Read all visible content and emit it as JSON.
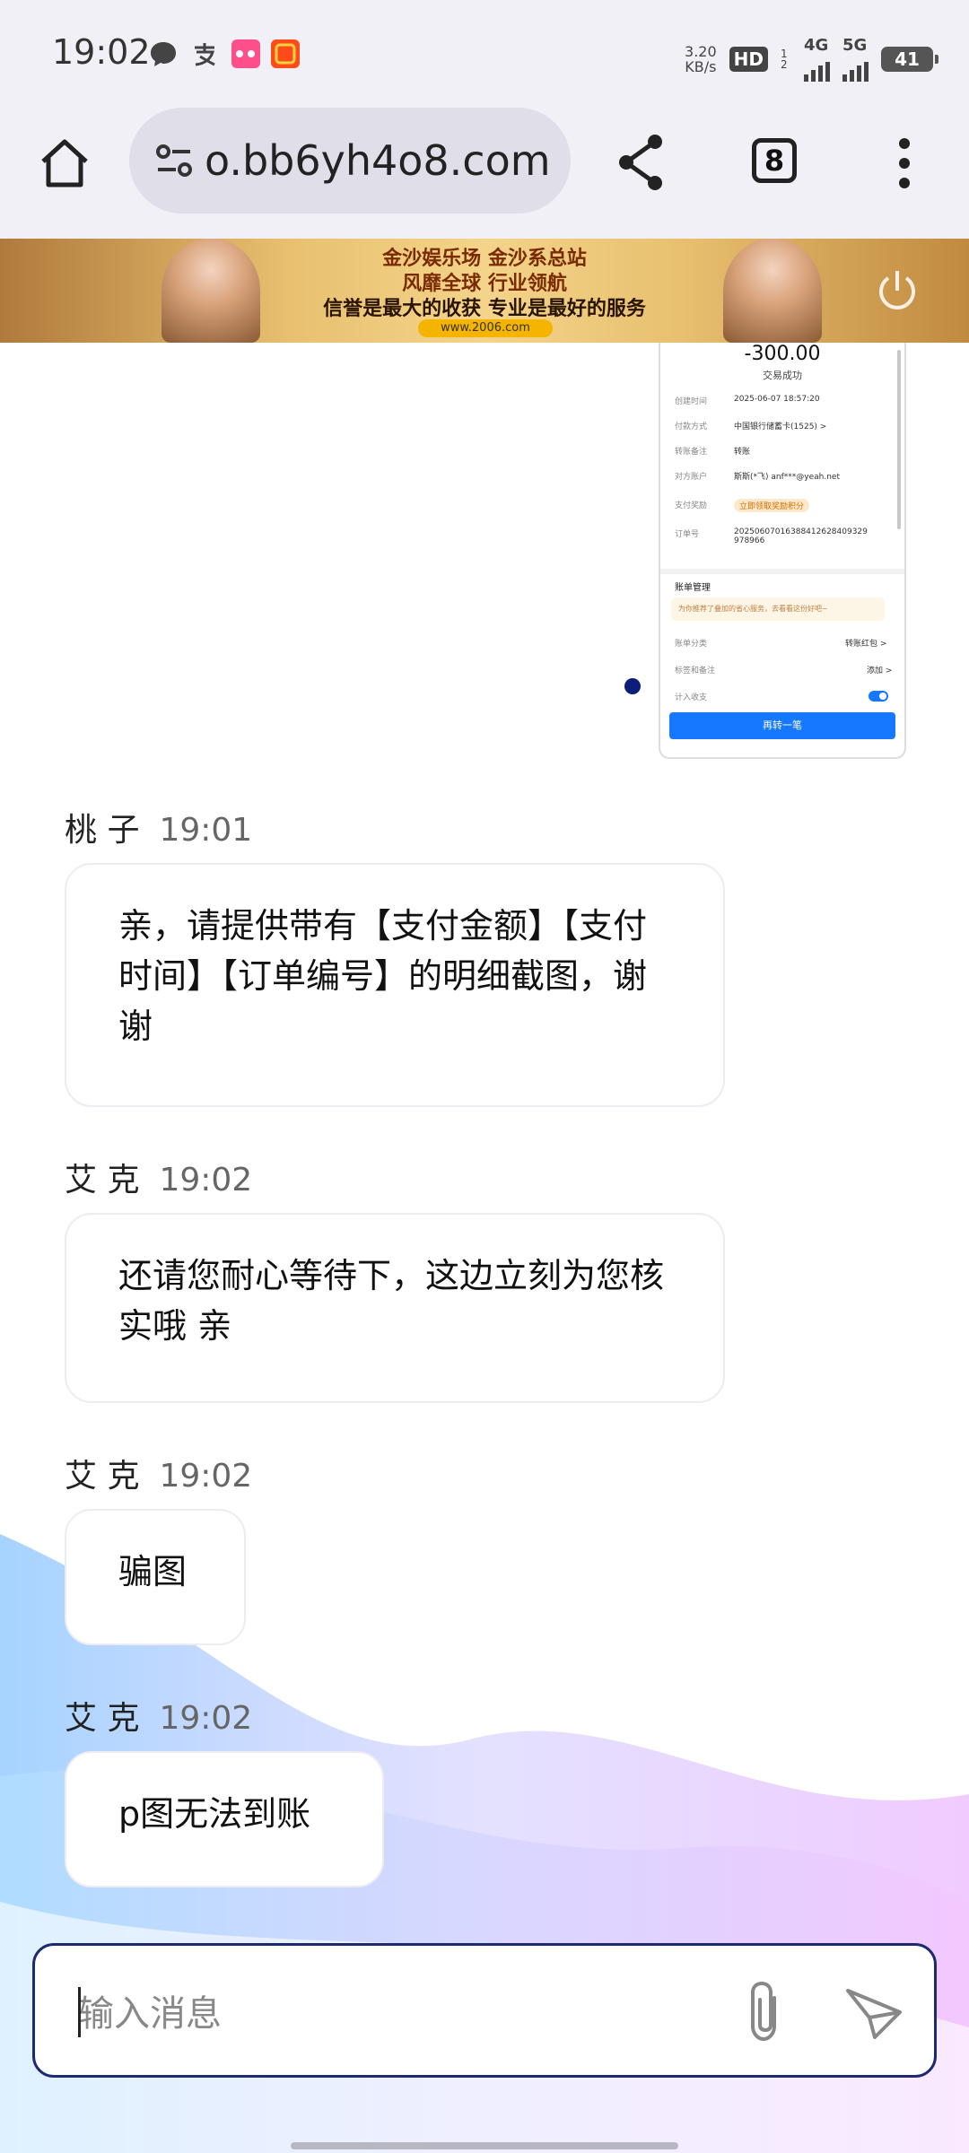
{
  "status_bar": {
    "time": "19:02",
    "net_speed_value": "3.20",
    "net_speed_unit": "KB/s",
    "hd_label": "HD",
    "hd_sub": "1 2",
    "net1": "4G",
    "net2": "5G",
    "battery": "41",
    "app_icons": [
      "message-icon",
      "alipay-icon",
      "lolo-icon",
      "taobao-icon"
    ]
  },
  "browser": {
    "url": "o.bb6yh4o8.com",
    "tab_count": "8"
  },
  "ad_banner": {
    "line1": "金沙娱乐场 金沙系总站",
    "line2": "风靡全球 行业领航",
    "line3": "信誉是最大的收获 专业是最好的服务",
    "url": "www.2006.com"
  },
  "receipt": {
    "amount": "-300.00",
    "status": "交易成功",
    "rows": [
      {
        "key": "创建时间",
        "value": "2025-06-07 18:57:20"
      },
      {
        "key": "付款方式",
        "value": "中国银行储蓄卡(1525) >"
      },
      {
        "key": "转账备注",
        "value": "转账"
      },
      {
        "key": "对方账户",
        "value": "斯斯(*飞) anf***@yeah.net"
      },
      {
        "key": "支付奖励",
        "value": "立即领取奖励积分"
      },
      {
        "key": "订单号",
        "value": "20250607016388412628409329978966"
      }
    ],
    "section": "账单管理",
    "tip": "为你推荐了叠加的省心服务，去看看这份好吧~",
    "links": [
      {
        "key": "账单分类",
        "value": "转账红包 >"
      },
      {
        "key": "标签和备注",
        "value": "添加 >"
      },
      {
        "key": "计入收支",
        "value": ""
      }
    ],
    "button": "再转一笔"
  },
  "messages": [
    {
      "sender": "桃 子",
      "time": "19:01",
      "text": "亲，请提供带有【支付金额】【支付时间】【订单编号】的明细截图，谢谢"
    },
    {
      "sender": "艾 克",
      "time": "19:02",
      "text": "还请您耐心等待下，这边立刻为您核实哦 亲"
    },
    {
      "sender": "艾 克",
      "time": "19:02",
      "text": "骗图"
    },
    {
      "sender": "艾 克",
      "time": "19:02",
      "text": "p图无法到账"
    }
  ],
  "composer": {
    "placeholder": "输入消息"
  },
  "colors": {
    "accent": "#1e2a70",
    "receipt_button": "#1677ff",
    "bubble_border": "#ececf2"
  }
}
